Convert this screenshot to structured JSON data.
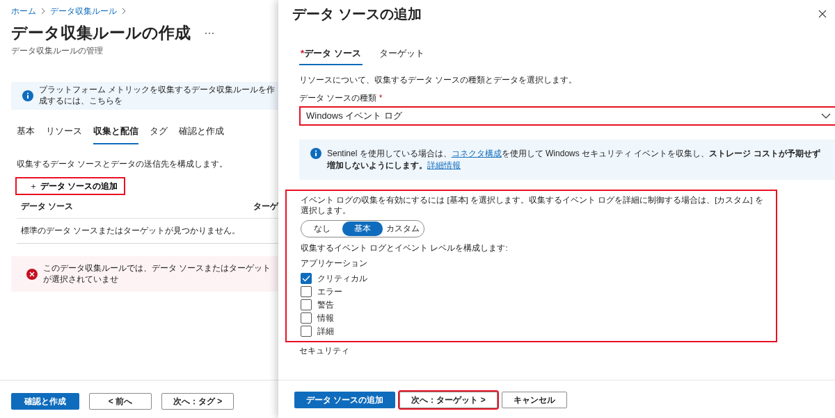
{
  "breadcrumb": [
    "ホーム",
    "データ収集ルール"
  ],
  "page": {
    "title": "データ収集ルールの作成",
    "subtitle": "データ収集ルールの管理"
  },
  "info_banner": {
    "text": "プラットフォーム メトリックを収集するデータ収集ルールを作成するには、こちらを"
  },
  "tabs": [
    {
      "label": "基本",
      "selected": false
    },
    {
      "label": "リソース",
      "selected": false
    },
    {
      "label": "収集と配信",
      "selected": true
    },
    {
      "label": "タグ",
      "selected": false
    },
    {
      "label": "確認と作成",
      "selected": false
    }
  ],
  "description": "収集するデータ ソースとデータの送信先を構成します。",
  "add_button": {
    "icon": "＋",
    "label": "データ ソースの追加",
    "highlighted": true
  },
  "table": {
    "columns": [
      "データ ソース",
      "ターゲ"
    ],
    "empty_message": "標準のデータ ソースまたはターゲットが見つかりません。"
  },
  "error_banner": {
    "text": "このデータ収集ルールでは、データ ソースまたはターゲットが選択されていませ"
  },
  "footer_buttons": [
    {
      "label": "確認と作成",
      "kind": "primary",
      "highlighted": false
    },
    {
      "label": "< 前へ",
      "kind": "secondary",
      "highlighted": false
    },
    {
      "label": "次へ：タグ >",
      "kind": "secondary",
      "highlighted": false
    }
  ],
  "panel": {
    "title": "データ ソースの追加",
    "tabs": [
      {
        "label": "データ ソース",
        "required_mark": "*",
        "selected": true
      },
      {
        "label": "ターゲット",
        "selected": false
      }
    ],
    "description": "リソースについて、収集するデータ ソースの種類とデータを選択します。",
    "source_type": {
      "label": "データ ソースの種類",
      "required_mark": "*",
      "value": "Windows イベント ログ",
      "highlighted": true
    },
    "info": {
      "parts": [
        {
          "kind": "text",
          "text": "Sentinel を使用している場合は、"
        },
        {
          "kind": "link",
          "text": "コネクタ構成"
        },
        {
          "kind": "text",
          "text": "を使用して Windows セキュリティ イベントを収集し、"
        },
        {
          "kind": "bold",
          "text": "ストレージ コストが予期せず増加しないようにします。"
        },
        {
          "kind": "link",
          "text": "詳細情報"
        }
      ]
    },
    "event_section": {
      "highlighted": true,
      "description": "イベント ログの収集を有効にするには [基本] を選択します。収集するイベント ログを詳細に制御する場合は、[カスタム] を選択します。",
      "modes": [
        {
          "label": "なし",
          "selected": false
        },
        {
          "label": "基本",
          "selected": true
        },
        {
          "label": "カスタム",
          "selected": false
        }
      ],
      "configure_label": "収集するイベント ログとイベント レベルを構成します:",
      "groups": [
        {
          "title": "アプリケーション",
          "items": [
            {
              "label": "クリティカル",
              "checked": true
            },
            {
              "label": "エラー",
              "checked": false
            },
            {
              "label": "警告",
              "checked": false
            },
            {
              "label": "情報",
              "checked": false
            },
            {
              "label": "詳細",
              "checked": false
            }
          ]
        }
      ]
    },
    "next_group_title": "セキュリティ",
    "footer_buttons": [
      {
        "label": "データ ソースの追加",
        "kind": "primary",
        "highlighted": false
      },
      {
        "label": "次へ：ターゲット >",
        "kind": "secondary",
        "highlighted": true
      },
      {
        "label": "キャンセル",
        "kind": "secondary",
        "highlighted": false
      }
    ]
  }
}
